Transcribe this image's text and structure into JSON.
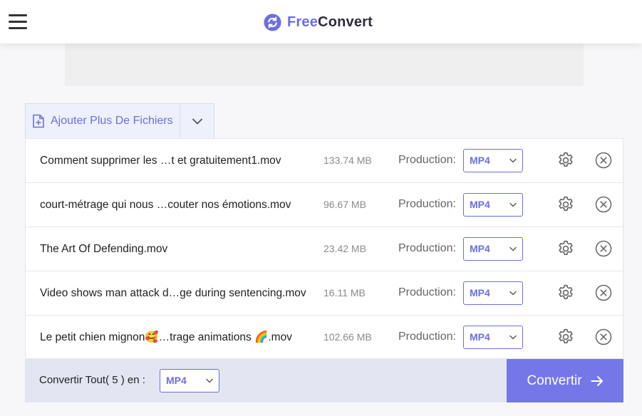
{
  "header": {
    "brand_part1": "Free",
    "brand_part2": "Convert",
    "brand_color": "#6b6fe0"
  },
  "icons": {
    "menu": "hamburger-icon",
    "logo": "sync-circle-icon",
    "add_file": "file-plus-icon",
    "dropdown": "chevron-down-icon",
    "settings": "gear-icon",
    "remove": "close-circle-icon",
    "convert": "arrow-right-icon"
  },
  "add_files": {
    "label": "Ajouter Plus De Fichiers"
  },
  "files": [
    {
      "name": "Comment supprimer les …t et gratuitement1.mov",
      "size": "133.74 MB",
      "production_label": "Production:",
      "format": "MP4"
    },
    {
      "name": "court-métrage qui nous …couter nos émotions.mov",
      "size": "96.67 MB",
      "production_label": "Production:",
      "format": "MP4"
    },
    {
      "name": "The Art Of Defending.mov",
      "size": "23.42 MB",
      "production_label": "Production:",
      "format": "MP4"
    },
    {
      "name": "Video shows man attack d…ge during sentencing.mov",
      "size": "16.11 MB",
      "production_label": "Production:",
      "format": "MP4"
    },
    {
      "name": "Le petit chien mignon🥰…trage animations 🌈.mov",
      "size": "102.66 MB",
      "production_label": "Production:",
      "format": "MP4"
    }
  ],
  "footer": {
    "convert_all_label": "Convertir Tout( 5 ) en :",
    "convert_all_format": "MP4",
    "convert_button": "Convertir"
  },
  "colors": {
    "accent": "#6b6fe0",
    "convert_button_bg": "#7577e8",
    "footer_bg": "#e3e5f3"
  }
}
